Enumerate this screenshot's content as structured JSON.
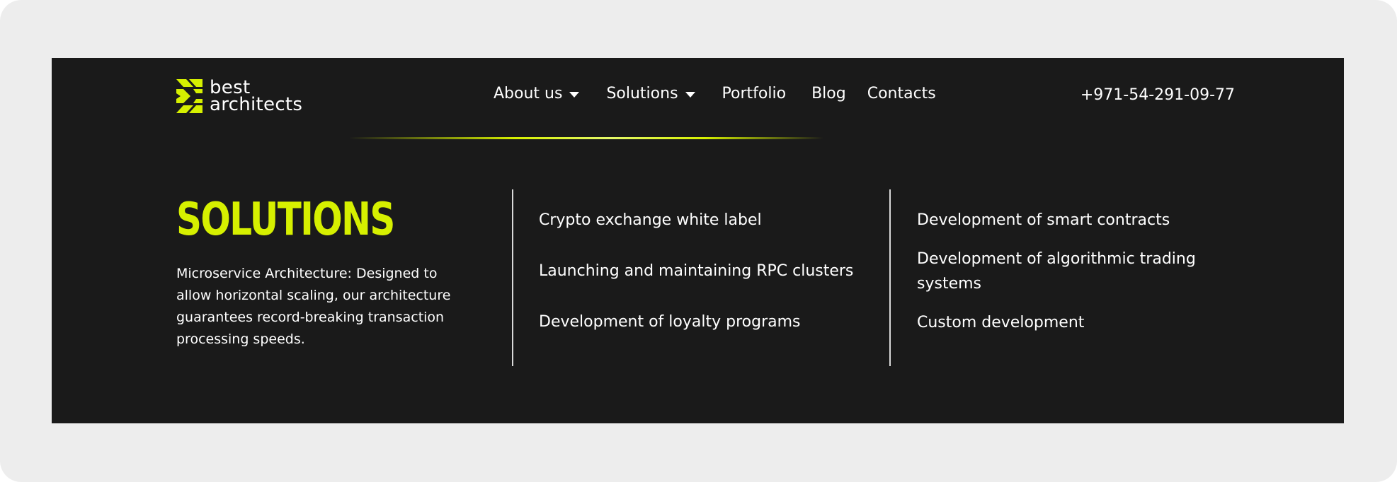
{
  "header": {
    "logo": {
      "line1": "best",
      "line2": "architects",
      "icon": "logo-mark-icon",
      "accent_color": "#d6f000"
    },
    "nav": [
      {
        "label": "About us",
        "has_dropdown": true
      },
      {
        "label": "Solutions",
        "has_dropdown": true
      },
      {
        "label": "Portfolio",
        "has_dropdown": false
      },
      {
        "label": "Blog",
        "has_dropdown": false
      },
      {
        "label": "Contacts",
        "has_dropdown": false
      }
    ],
    "phone": "+971-54-291-09-77"
  },
  "dropdown": {
    "title": "SOLUTIONS",
    "description": "Microservice Architecture: Designed to allow horizontal scaling, our architecture guarantees record-breaking transaction processing speeds.",
    "column1": [
      "Crypto exchange white label",
      "Launching and maintaining RPC clusters",
      "Development of loyalty programs"
    ],
    "column2": [
      "Development of smart contracts",
      "Development of algorithmic trading systems",
      "Custom development"
    ]
  },
  "colors": {
    "panel_background": "#1a1a1a",
    "page_background": "#ededed",
    "accent": "#d6f000",
    "text": "#ffffff"
  }
}
